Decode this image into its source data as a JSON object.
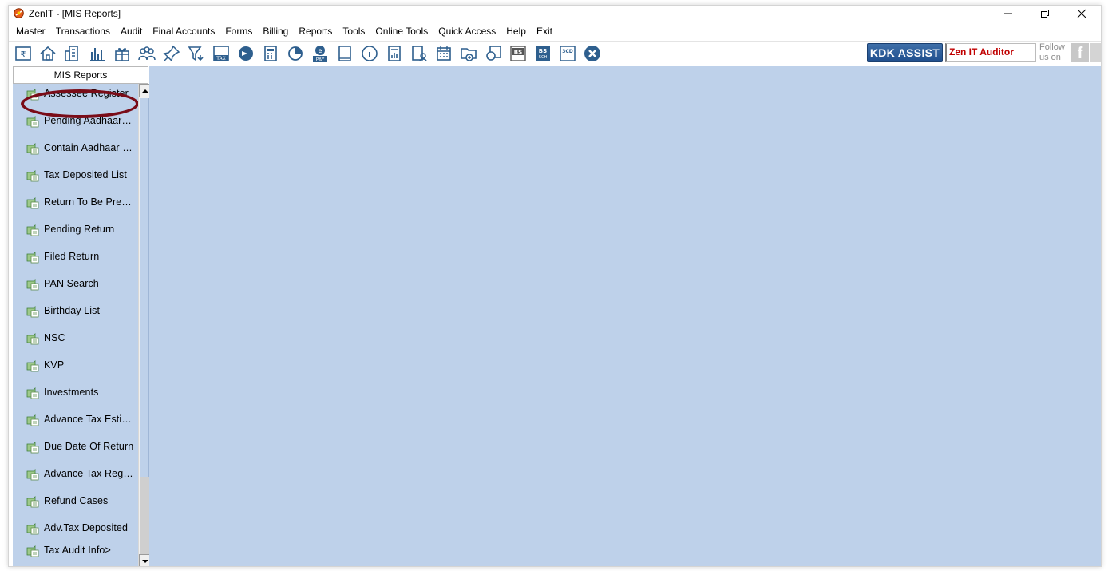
{
  "window": {
    "title": "ZenIT - [MIS Reports]",
    "controls": [
      "minimize-icon",
      "restore-icon",
      "close-icon"
    ]
  },
  "menubar": {
    "items": [
      "Master",
      "Transactions",
      "Audit",
      "Final Accounts",
      "Forms",
      "Billing",
      "Reports",
      "Tools",
      "Online Tools",
      "Quick Access",
      "Help",
      "Exit"
    ]
  },
  "toolbar": {
    "icons": [
      "receipt-icon",
      "home-icon",
      "ledger-icon",
      "bar-chart-icon",
      "gift-icon",
      "users-icon",
      "pin-icon",
      "filter-icon",
      "tax-icon",
      "chat-icon",
      "calculator-icon",
      "pie-icon",
      "epay-icon",
      "book-icon",
      "info-icon",
      "report-icon",
      "user-report-icon",
      "calendar-icon",
      "folder-add-icon",
      "copy-icon",
      "bs-icon",
      "bs-sch-icon",
      "3cd-icon",
      "close-circle-icon"
    ],
    "kdk_assist_label": "KDK ASSIST",
    "product_name": "Zen IT Auditor",
    "follow_line1": "Follow",
    "follow_line2": "us on",
    "fb_letter": "f"
  },
  "side_panel": {
    "header": "MIS Reports",
    "items": [
      "Assessee Register",
      "Pending Aadhaar Number",
      "Contain Aadhaar Number",
      "Tax Deposited List",
      "Return To Be Prepared",
      "Pending Return",
      "Filed Return",
      "PAN Search",
      "Birthday List",
      "NSC",
      "KVP",
      "Investments",
      "Advance Tax Estimation",
      "Due Date Of Return",
      "Advance Tax Register",
      "Refund Cases",
      "Adv.Tax Deposited",
      "Tax Audit Info>"
    ],
    "highlighted_item": "Assessee Register"
  },
  "colors": {
    "panel_bg": "#bed1ea",
    "kdk_button": "#2a5a98",
    "product_text": "#c00000",
    "highlight_ring": "#7a0c18"
  }
}
